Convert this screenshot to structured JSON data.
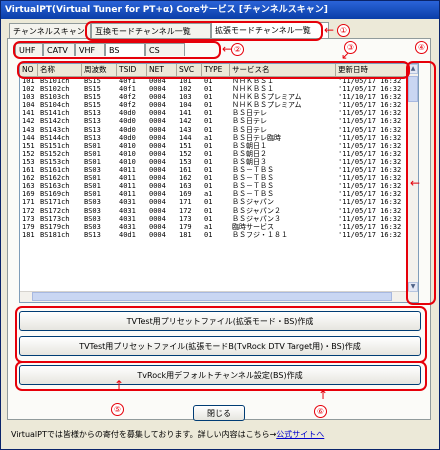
{
  "window": {
    "title": "VirtualPT(Virtual Tuner for PT+α) Coreサービス [チャンネルスキャン]"
  },
  "tabs": [
    {
      "label": "チャンネルスキャン"
    },
    {
      "label": "互換モードチャンネル一覧"
    },
    {
      "label": "拡張モードチャンネル一覧"
    }
  ],
  "subtabs": [
    {
      "label": "UHF"
    },
    {
      "label": "CATV"
    },
    {
      "label": "VHF"
    },
    {
      "label": "BS"
    },
    {
      "label": "CS"
    }
  ],
  "columns": [
    "NO",
    "名称",
    "周波数",
    "TSID",
    "NET",
    "SVC",
    "TYPE",
    "サービス名",
    "更新日時"
  ],
  "rows": [
    [
      "101",
      "BS101ch",
      "BS15",
      "40f1",
      "0004",
      "101",
      "01",
      "ＮＨＫＢＳ１",
      "'11/05/17 16:32"
    ],
    [
      "102",
      "BS102ch",
      "BS15",
      "40f1",
      "0004",
      "102",
      "01",
      "ＮＨＫＢＳ１",
      "'11/05/17 16:32"
    ],
    [
      "103",
      "BS103ch",
      "BS15",
      "40f2",
      "0004",
      "103",
      "01",
      "ＮＨＫＢＳプレミアム",
      "'11/10/17 16:32"
    ],
    [
      "104",
      "BS104ch",
      "BS15",
      "40f2",
      "0004",
      "104",
      "01",
      "ＮＨＫＢＳプレミアム",
      "'11/05/17 16:32"
    ],
    [
      "141",
      "BS141ch",
      "BS13",
      "40d0",
      "0004",
      "141",
      "01",
      "ＢＳ日テレ",
      "'11/05/17 16:32"
    ],
    [
      "142",
      "BS142ch",
      "BS13",
      "40d0",
      "0004",
      "142",
      "01",
      "ＢＳ日テレ",
      "'11/05/17 16:32"
    ],
    [
      "143",
      "BS143ch",
      "BS13",
      "40d0",
      "0004",
      "143",
      "01",
      "ＢＳ日テレ",
      "'11/05/17 16:32"
    ],
    [
      "144",
      "BS144ch",
      "BS13",
      "40d0",
      "0004",
      "144",
      "a1",
      "ＢＳ日テレ臨時",
      "'11/05/17 16:32"
    ],
    [
      "151",
      "BS151ch",
      "BS01",
      "4010",
      "0004",
      "151",
      "01",
      "ＢＳ朝日１",
      "'11/05/17 16:32"
    ],
    [
      "152",
      "BS152ch",
      "BS01",
      "4010",
      "0004",
      "152",
      "01",
      "ＢＳ朝日２",
      "'11/05/17 16:32"
    ],
    [
      "153",
      "BS153ch",
      "BS01",
      "4010",
      "0004",
      "153",
      "01",
      "ＢＳ朝日３",
      "'11/05/17 16:32"
    ],
    [
      "161",
      "BS161ch",
      "BS03",
      "4011",
      "0004",
      "161",
      "01",
      "ＢＳ－ＴＢＳ",
      "'11/05/17 16:32"
    ],
    [
      "162",
      "BS162ch",
      "BS01",
      "4011",
      "0004",
      "162",
      "01",
      "ＢＳ－ＴＢＳ",
      "'11/05/17 16:32"
    ],
    [
      "163",
      "BS163ch",
      "BS01",
      "4011",
      "0004",
      "163",
      "01",
      "ＢＳ－ＴＢＳ",
      "'11/05/17 16:32"
    ],
    [
      "169",
      "BS169ch",
      "BS01",
      "4011",
      "0004",
      "169",
      "a1",
      "ＢＳ－ＴＢＳ",
      "'11/05/17 16:32"
    ],
    [
      "171",
      "BS171ch",
      "BS03",
      "4031",
      "0004",
      "171",
      "01",
      "ＢＳジャパン",
      "'11/05/17 16:32"
    ],
    [
      "172",
      "BS172ch",
      "BS03",
      "4031",
      "0004",
      "172",
      "01",
      "ＢＳジャパン２",
      "'11/05/17 16:32"
    ],
    [
      "173",
      "BS173ch",
      "BS03",
      "4031",
      "0004",
      "173",
      "01",
      "ＢＳジャパン３",
      "'11/05/17 16:32"
    ],
    [
      "179",
      "BS179ch",
      "BS03",
      "4031",
      "0004",
      "179",
      "a1",
      "臨時サービス",
      "'11/05/17 16:32"
    ],
    [
      "181",
      "BS181ch",
      "BS13",
      "40d1",
      "0004",
      "181",
      "01",
      "ＢＳフジ・１８１",
      "'11/05/17 16:32"
    ]
  ],
  "buttons": {
    "preset_ext_bs": "TVTest用プリセットファイル(拡張モード・BS)作成",
    "preset_ext_bs_rock": "TVTest用プリセットファイル(拡張モードB(TvRock DTV Target用)・BS)作成",
    "tvrock_default": "TvRock用デフォルトチャンネル設定(BS)作成",
    "close": "閉じる"
  },
  "footer": {
    "text": "VirtualPTでは皆様からの寄付を募集しております。詳しい内容はこちら→",
    "link": "公式サイトへ"
  },
  "annotations": [
    "①",
    "②",
    "③",
    "④",
    "⑤",
    "⑥"
  ],
  "colors": {
    "annotation": "#e6000a",
    "titlebar": "#0a3ea8",
    "link": "#0000cc"
  }
}
